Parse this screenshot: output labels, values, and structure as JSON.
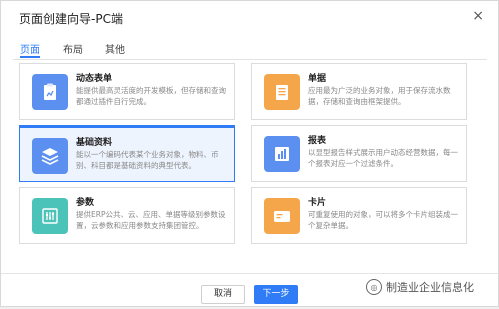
{
  "dialog": {
    "title": "页面创建向导-PC端",
    "close_glyph": "×"
  },
  "tabs": [
    {
      "label": "页面",
      "active": true
    },
    {
      "label": "布局",
      "active": false
    },
    {
      "label": "其他",
      "active": false
    }
  ],
  "cards": [
    {
      "title": "动态表单",
      "desc": "能提供最高灵活度的开发模板，但存储和查询都通过插件自行完成。",
      "icon": "form-icon",
      "color": "#5b8ff0"
    },
    {
      "title": "单据",
      "desc": "应用最为广泛的业务对象，用于保存流水数据，存储和查询由框架提供。",
      "icon": "document-icon",
      "color": "#f5a54a"
    },
    {
      "title": "基础资料",
      "desc": "能以一个编码代表某个业务对象，物料、币别、科目都是基础资料的典型代表。",
      "icon": "layers-icon",
      "color": "#5b8ff0",
      "selected": true
    },
    {
      "title": "报表",
      "desc": "以显型报告样式展示用户动态经营数据，每一个报表对应一个过滤条件。",
      "icon": "report-icon",
      "color": "#5b8ff0"
    },
    {
      "title": "参数",
      "desc": "提供ERP公共、云、应用、单据等级别参数设置，云参数和应用参数支持集团管控。",
      "icon": "sliders-icon",
      "color": "#4cc3b9"
    },
    {
      "title": "卡片",
      "desc": "可重复使用的对象，可以将多个卡片组装成一个复杂单据。",
      "icon": "card-icon",
      "color": "#f5a54a"
    }
  ],
  "footer": {
    "cancel_label": "取消",
    "next_label": "下一步"
  },
  "watermark": {
    "text": "制造业企业信息化"
  }
}
